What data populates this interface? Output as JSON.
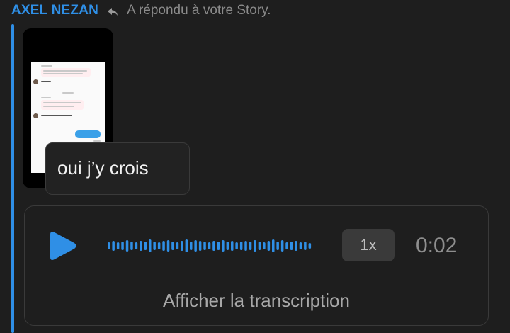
{
  "message": {
    "sender": "AXEL NEZAN",
    "reply_context": "A répondu à votre Story.",
    "caption": "oui j’y crois"
  },
  "voice_note": {
    "speed": "1x",
    "duration": "0:02",
    "transcript_link": "Afficher la transcription"
  },
  "colors": {
    "accent": "#2f8fe6",
    "background": "#1e1e1e",
    "muted_text": "#8b8b8b"
  },
  "icons": {
    "reply": "reply-arrow-icon",
    "play": "play-icon",
    "waveform": "waveform-icon"
  }
}
